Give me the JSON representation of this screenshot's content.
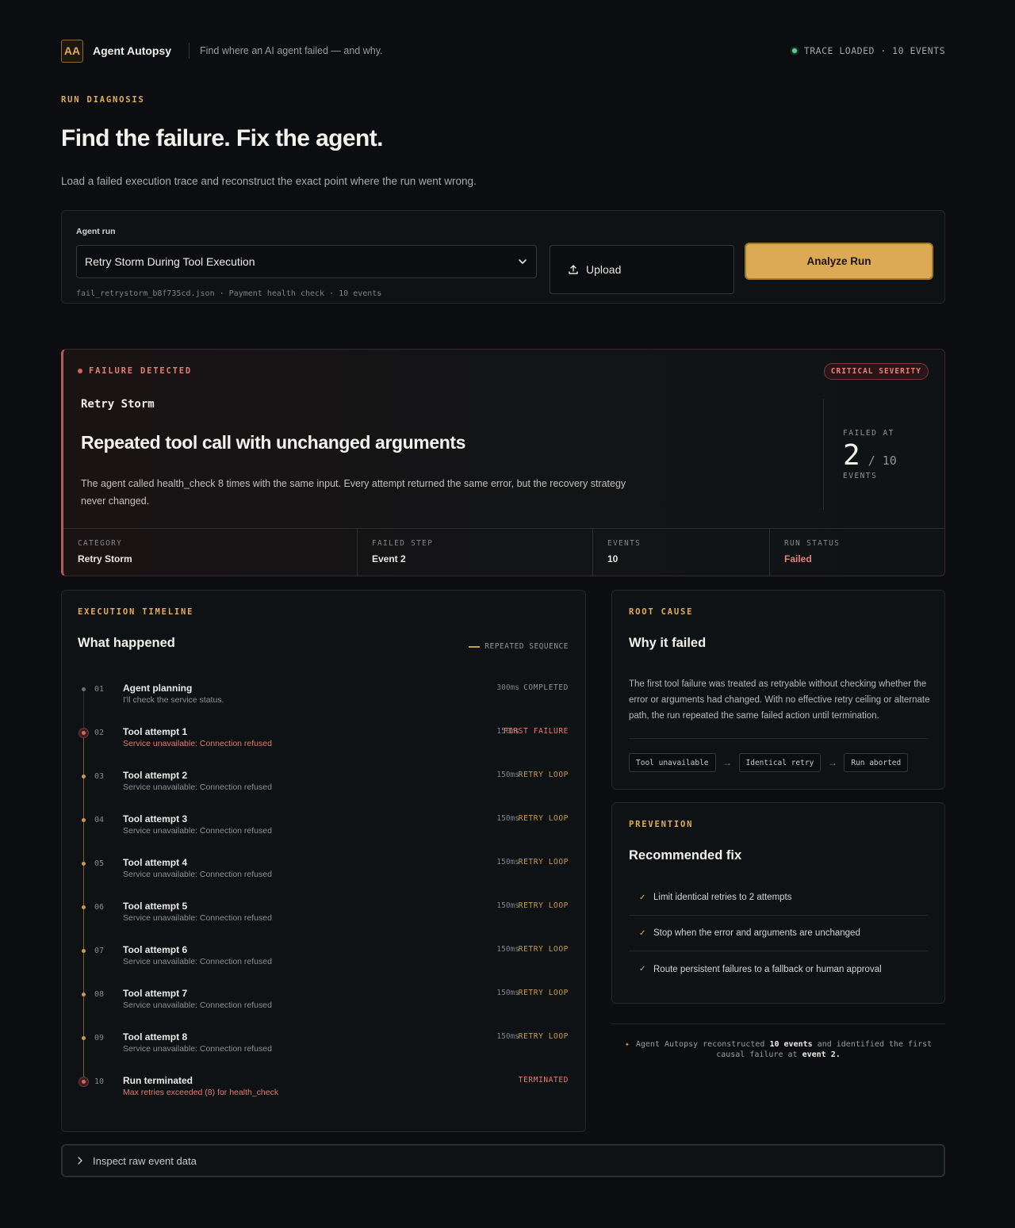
{
  "header": {
    "logo": "AA",
    "brand": "Agent Autopsy",
    "tagline": "Find where an AI agent failed — and why.",
    "status": "TRACE LOADED · 10 EVENTS"
  },
  "hero": {
    "eyebrow": "RUN DIAGNOSIS",
    "title": "Find the failure. Fix the agent.",
    "subtitle": "Load a failed execution trace and reconstruct the exact point where the run went wrong."
  },
  "run": {
    "label": "Agent run",
    "selected": "Retry Storm During Tool Execution",
    "meta": "fail_retrystorm_b8f735cd.json · Payment health check · 10 events",
    "upload_label": "Upload",
    "analyze_label": "Analyze Run"
  },
  "failure": {
    "eyebrow": "FAILURE DETECTED",
    "severity": "CRITICAL SEVERITY",
    "kind": "Retry Storm",
    "title": "Repeated tool call with unchanged arguments",
    "description": "The agent called health_check 8 times with the same input. Every attempt returned the same error, but the recovery strategy never changed.",
    "failed_at_label": "FAILED AT",
    "failed_at": "2",
    "failed_total": "/ 10",
    "events_label": "EVENTS",
    "stats": [
      {
        "key": "CATEGORY",
        "value": "Retry Storm"
      },
      {
        "key": "FAILED STEP",
        "value": "Event 2"
      },
      {
        "key": "EVENTS",
        "value": "10"
      },
      {
        "key": "RUN STATUS",
        "value": "Failed"
      }
    ]
  },
  "timeline": {
    "eyebrow": "EXECUTION TIMELINE",
    "title": "What happened",
    "legend": "REPEATED SEQUENCE",
    "events": [
      {
        "num": "01",
        "name": "Agent planning",
        "detail": "I'll check the service status.",
        "duration": "300ms",
        "state": "COMPLETED"
      },
      {
        "num": "02",
        "name": "Tool attempt 1",
        "detail": "Service unavailable: Connection refused",
        "duration": "150ms",
        "state": "FIRST FAILURE"
      },
      {
        "num": "03",
        "name": "Tool attempt 2",
        "detail": "Service unavailable: Connection refused",
        "duration": "150ms",
        "state": "RETRY LOOP"
      },
      {
        "num": "04",
        "name": "Tool attempt 3",
        "detail": "Service unavailable: Connection refused",
        "duration": "150ms",
        "state": "RETRY LOOP"
      },
      {
        "num": "05",
        "name": "Tool attempt 4",
        "detail": "Service unavailable: Connection refused",
        "duration": "150ms",
        "state": "RETRY LOOP"
      },
      {
        "num": "06",
        "name": "Tool attempt 5",
        "detail": "Service unavailable: Connection refused",
        "duration": "150ms",
        "state": "RETRY LOOP"
      },
      {
        "num": "07",
        "name": "Tool attempt 6",
        "detail": "Service unavailable: Connection refused",
        "duration": "150ms",
        "state": "RETRY LOOP"
      },
      {
        "num": "08",
        "name": "Tool attempt 7",
        "detail": "Service unavailable: Connection refused",
        "duration": "150ms",
        "state": "RETRY LOOP"
      },
      {
        "num": "09",
        "name": "Tool attempt 8",
        "detail": "Service unavailable: Connection refused",
        "duration": "150ms",
        "state": "RETRY LOOP"
      },
      {
        "num": "10",
        "name": "Run terminated",
        "detail": "Max retries exceeded (8) for health_check",
        "duration": "",
        "state": "TERMINATED"
      }
    ]
  },
  "root_cause": {
    "eyebrow": "ROOT CAUSE",
    "title": "Why it failed",
    "description": "The first tool failure was treated as retryable without checking whether the error or arguments had changed. With no effective retry ceiling or alternate path, the run repeated the same failed action until termination.",
    "chain": [
      "Tool unavailable",
      "Identical retry",
      "Run aborted"
    ]
  },
  "prevention": {
    "eyebrow": "PREVENTION",
    "title": "Recommended fix",
    "fixes": [
      "Limit identical retries to 2 attempts",
      "Stop when the error and arguments are unchanged",
      "Route persistent failures to a fallback or human approval"
    ]
  },
  "summary": {
    "prefix": "Agent Autopsy reconstructed",
    "events": "10 events",
    "middle": "and identified the first causal failure at",
    "event": "event 2",
    "suffix": "."
  },
  "raw": {
    "label": "Inspect raw event data"
  }
}
